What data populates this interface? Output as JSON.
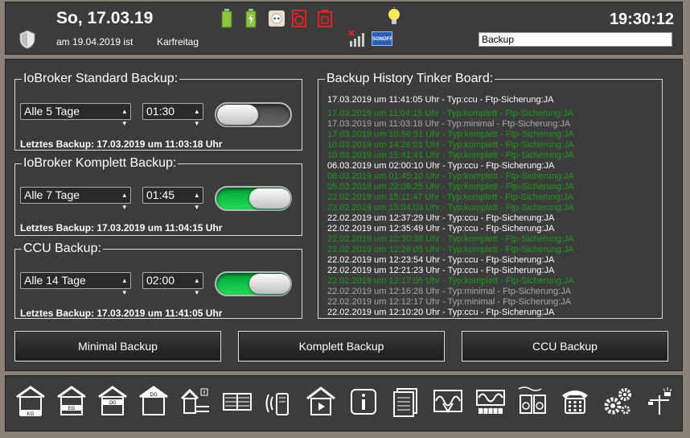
{
  "header": {
    "date": "So, 17.03.19",
    "holiday_date": "am 19.04.2019 ist",
    "holiday_name": "Karfreitag",
    "time": "19:30:12",
    "search_value": "Backup",
    "brand_label": "SONOFF"
  },
  "standard_backup": {
    "title": "IoBroker Standard Backup:",
    "interval": "Alle 5 Tage",
    "time": "01:30",
    "enabled": false,
    "last": "Letztes Backup: 17.03.2019 um 11:03:18 Uhr"
  },
  "komplett_backup": {
    "title": "IoBroker Komplett Backup:",
    "interval": "Alle 7 Tage",
    "time": "01:45",
    "enabled": true,
    "last": "Letztes Backup: 17.03.2019 um 11:04:15 Uhr"
  },
  "ccu_backup": {
    "title": "CCU Backup:",
    "interval": "Alle 14 Tage",
    "time": "02:00",
    "enabled": true,
    "last": "Letztes Backup: 17.03.2019 um 11:41:05 Uhr"
  },
  "history": {
    "title": "Backup History Tinker Board:",
    "entries": [
      {
        "text": "17.03.2019 um 11:41:05 Uhr - Typ:ccu - Ftp-Sicherung:JA",
        "color": "#ffffff"
      },
      {
        "text": "17.03.2019 um 11:04:15 Uhr - Typ:komplett - Ftp-Sicherung:JA",
        "color": "#1a9a1a"
      },
      {
        "text": "17.03.2019 um 11:03:18 Uhr - Typ:minimal - Ftp-Sicherung:JA",
        "color": "#aaaaaa"
      },
      {
        "text": "17.03.2019 um 10:56:51 Uhr - Typ:komplett - Ftp-Sicherung:JA",
        "color": "#1a9a1a"
      },
      {
        "text": "10.03.2019 um 14:26:01 Uhr - Typ:komplett - Ftp-Sicherung:JA",
        "color": "#1a9a1a"
      },
      {
        "text": "10.03.2019 um 15:41:41 Uhr - Typ:komplett - Ftp-Sicherung:JA",
        "color": "#1a9a1a"
      },
      {
        "text": "06.03.2019 um 02:00:10 Uhr - Typ:ccu - Ftp-Sicherung:JA",
        "color": "#ffffff"
      },
      {
        "text": "06.03.2019 um 01:45:10 Uhr - Typ:komplett - Ftp-Sicherung:JA",
        "color": "#1a9a1a"
      },
      {
        "text": "05.03.2019 um 22:09:25 Uhr - Typ:komplett - Ftp-Sicherung:JA",
        "color": "#1a9a1a"
      },
      {
        "text": "22.02.2019 um 15:11:47 Uhr - Typ:komplett - Ftp-Sicherung:JA",
        "color": "#1a9a1a"
      },
      {
        "text": "22.02.2019 um 15:04:03 Uhr - Typ:komplett - Ftp-Sicherung:JA",
        "color": "#1a9a1a"
      },
      {
        "text": "22.02.2019 um 12:37:29 Uhr - Typ:ccu - Ftp-Sicherung:JA",
        "color": "#ffffff"
      },
      {
        "text": "22.02.2019 um 12:35:49 Uhr - Typ:ccu - Ftp-Sicherung:JA",
        "color": "#ffffff"
      },
      {
        "text": "22.02.2019 um 12:30:38 Uhr - Typ:komplett - Ftp-Sicherung:JA",
        "color": "#1a9a1a"
      },
      {
        "text": "22.02.2019 um 12:26:05 Uhr - Typ:komplett - Ftp-Sicherung:JA",
        "color": "#1a9a1a"
      },
      {
        "text": "22.02.2019 um 12:23:54 Uhr - Typ:ccu - Ftp-Sicherung:JA",
        "color": "#ffffff"
      },
      {
        "text": "22.02.2019 um 12:21:23 Uhr - Typ:ccu - Ftp-Sicherung:JA",
        "color": "#ffffff"
      },
      {
        "text": "22.02.2019 um 12:17:05 Uhr - Typ:komplett - Ftp-Sicherung:JA",
        "color": "#1a9a1a"
      },
      {
        "text": "22.02.2019 um 12:16:28 Uhr - Typ:minimal - Ftp-Sicherung:JA",
        "color": "#aaaaaa"
      },
      {
        "text": "22.02.2019 um 12:12:17 Uhr - Typ:minimal - Ftp-Sicherung:JA",
        "color": "#aaaaaa"
      },
      {
        "text": "22.02.2019 um 12:10:20 Uhr - Typ:ccu - Ftp-Sicherung:JA",
        "color": "#ffffff"
      }
    ]
  },
  "buttons": {
    "minimal": "Minimal Backup",
    "komplett": "Komplett Backup",
    "ccu": "CCU Backup"
  },
  "nav": {
    "icons": [
      "house-kg-icon",
      "house-eg-icon",
      "house-og-icon",
      "house-dg-icon",
      "garden-house-icon",
      "blinds-icon",
      "phone-signal-icon",
      "house-media-icon",
      "info-icon",
      "documents-icon",
      "sine-wave-meter-icon",
      "power-meter-icon",
      "washing-machine-icon",
      "telephone-icon",
      "settings-gears-icon",
      "outdoor-light-icon"
    ],
    "floor_labels": [
      "KG",
      "EG",
      "OG",
      "DG"
    ]
  },
  "colors": {
    "panel": "#3c3c3c",
    "accent_green": "#1a9a1a",
    "battery_green": "#8cc63f",
    "alert_red": "#e22222"
  }
}
